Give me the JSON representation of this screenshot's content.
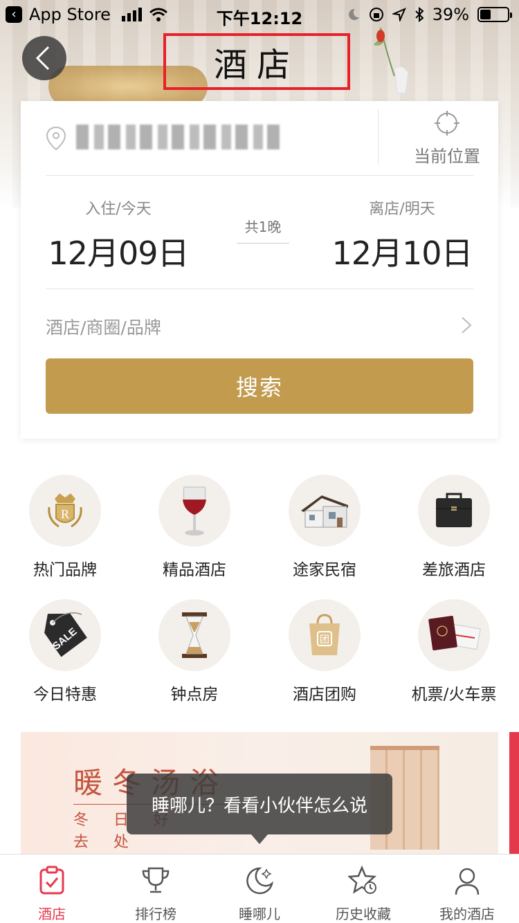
{
  "status_bar": {
    "back_app": "App Store",
    "time": "下午12:12",
    "battery": "39%",
    "battery_level": 0.39
  },
  "header": {
    "title": "酒店"
  },
  "search_card": {
    "current_location_label": "当前位置",
    "checkin_label": "入住/今天",
    "checkin_date": "12月09日",
    "nights": "共1晚",
    "checkout_label": "离店/明天",
    "checkout_date": "12月10日",
    "brand_placeholder": "酒店/商圈/品牌",
    "search_button": "搜索"
  },
  "categories": [
    {
      "label": "热门品牌",
      "icon": "crown-emblem-icon"
    },
    {
      "label": "精品酒店",
      "icon": "wine-glass-icon"
    },
    {
      "label": "途家民宿",
      "icon": "house-icon"
    },
    {
      "label": "差旅酒店",
      "icon": "briefcase-icon"
    },
    {
      "label": "今日特惠",
      "icon": "sale-tag-icon"
    },
    {
      "label": "钟点房",
      "icon": "hourglass-icon"
    },
    {
      "label": "酒店团购",
      "icon": "group-buy-bag-icon"
    },
    {
      "label": "机票/火车票",
      "icon": "ticket-passport-icon"
    }
  ],
  "banner": {
    "title": "暖冬汤浴",
    "subtitle": "冬日好去处"
  },
  "tooltip": "睡哪儿？看看小伙伴怎么说",
  "tabbar": [
    {
      "label": "酒店",
      "icon": "hotel-clipboard-icon",
      "active": true
    },
    {
      "label": "排行榜",
      "icon": "trophy-icon",
      "active": false
    },
    {
      "label": "睡哪儿",
      "icon": "moon-star-icon",
      "active": false
    },
    {
      "label": "历史收藏",
      "icon": "star-clock-icon",
      "active": false
    },
    {
      "label": "我的酒店",
      "icon": "user-icon",
      "active": false
    }
  ],
  "colors": {
    "accent_gold": "#c29b4e",
    "active_red": "#e8384f",
    "highlight_red": "#e8202a"
  }
}
